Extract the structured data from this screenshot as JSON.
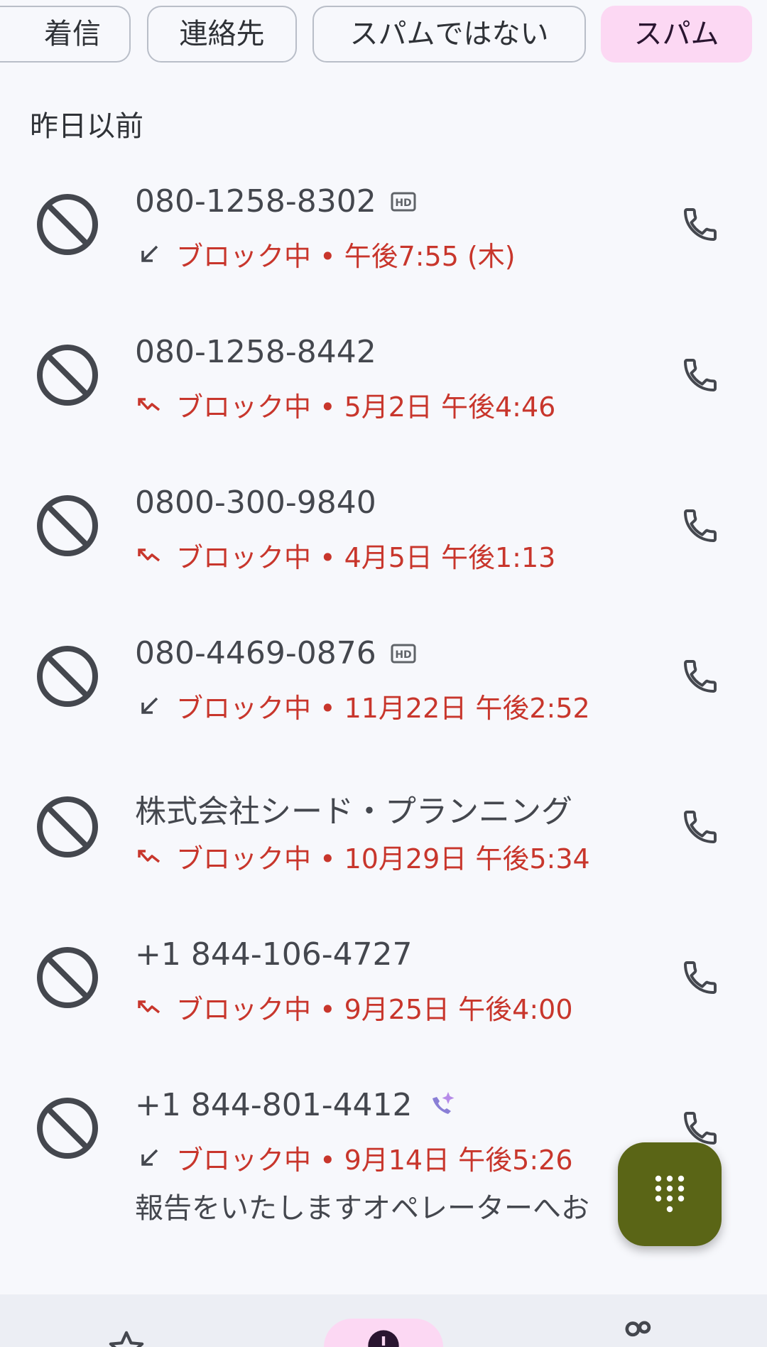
{
  "filters": {
    "chips": [
      {
        "label": "着信",
        "selected": false
      },
      {
        "label": "連絡先",
        "selected": false
      },
      {
        "label": "スパムではない",
        "selected": false
      },
      {
        "label": "スパム",
        "selected": true
      }
    ]
  },
  "section": {
    "title": "昨日以前"
  },
  "calls": [
    {
      "number": "080-1258-8302",
      "tag": "hd-icon",
      "direction": "incoming-arrow-icon",
      "status": "ブロック中 • 午後7:55 (木)"
    },
    {
      "number": "080-1258-8442",
      "tag": "",
      "direction": "missed-call-icon",
      "status": "ブロック中 • 5月2日 午後4:46"
    },
    {
      "number": "0800-300-9840",
      "tag": "",
      "direction": "missed-call-icon",
      "status": "ブロック中 • 4月5日 午後1:13"
    },
    {
      "number": "080-4469-0876",
      "tag": "hd-icon",
      "direction": "incoming-arrow-icon",
      "status": "ブロック中 • 11月22日 午後2:52"
    },
    {
      "number": "株式会社シード・プランニング",
      "tag": "",
      "direction": "missed-call-icon",
      "status": "ブロック中 • 10月29日 午後5:34"
    },
    {
      "number": "+1 844-106-4727",
      "tag": "",
      "direction": "missed-call-icon",
      "status": "ブロック中 • 9月25日 午後4:00"
    },
    {
      "number": "+1 844-801-4412",
      "tag": "ai-sparkle-phone-icon",
      "direction": "incoming-arrow-icon",
      "status": "ブロック中 • 9月14日 午後5:26",
      "transcript": "報告をいたしますオペレーターへお"
    }
  ],
  "colors": {
    "accent_chip": "#fcd8f3",
    "blocked_text": "#c8362c",
    "fab": "#5a6516",
    "background": "#f7f8fc"
  },
  "bottom_nav": {
    "items": [
      "star-icon",
      "recents-icon",
      "contacts-icon"
    ]
  }
}
